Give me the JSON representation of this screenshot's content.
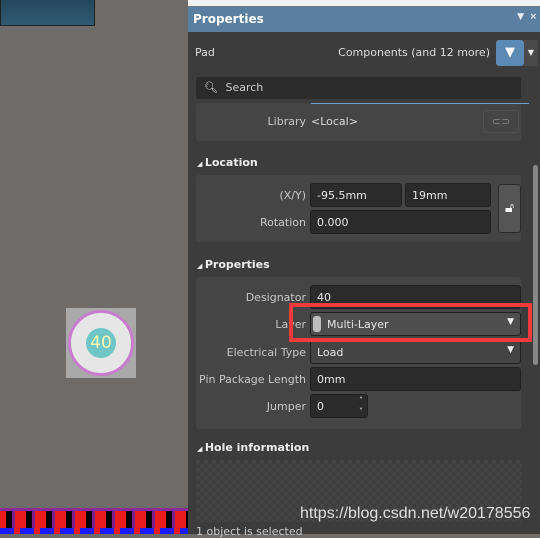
{
  "canvas": {
    "pad_designator": "40"
  },
  "panel": {
    "title": "Properties",
    "object_type": "Pad",
    "filter_text": "Components (and 12 more)",
    "search_placeholder": "Search",
    "library": {
      "label": "Library",
      "value": "<Local>"
    },
    "location": {
      "header": "Location",
      "xy_label": "(X/Y)",
      "x": "-95.5mm",
      "y": "19mm",
      "rotation_label": "Rotation",
      "rotation": "0.000"
    },
    "properties": {
      "header": "Properties",
      "designator_label": "Designator",
      "designator": "40",
      "layer_label": "Layer",
      "layer": "Multi-Layer",
      "electrical_type_label": "Electrical Type",
      "electrical_type": "Load",
      "pin_package_length_label": "Pin Package Length",
      "pin_package_length": "0mm",
      "jumper_label": "Jumper",
      "jumper": "0"
    },
    "hole": {
      "header": "Hole information"
    },
    "status": "1 object is selected"
  },
  "watermark": "https://blog.csdn.net/w20178556",
  "colors": {
    "title_bar": "#5b7fa0",
    "highlight": "#ef3b3b",
    "filter_button": "#5b8ab5"
  }
}
